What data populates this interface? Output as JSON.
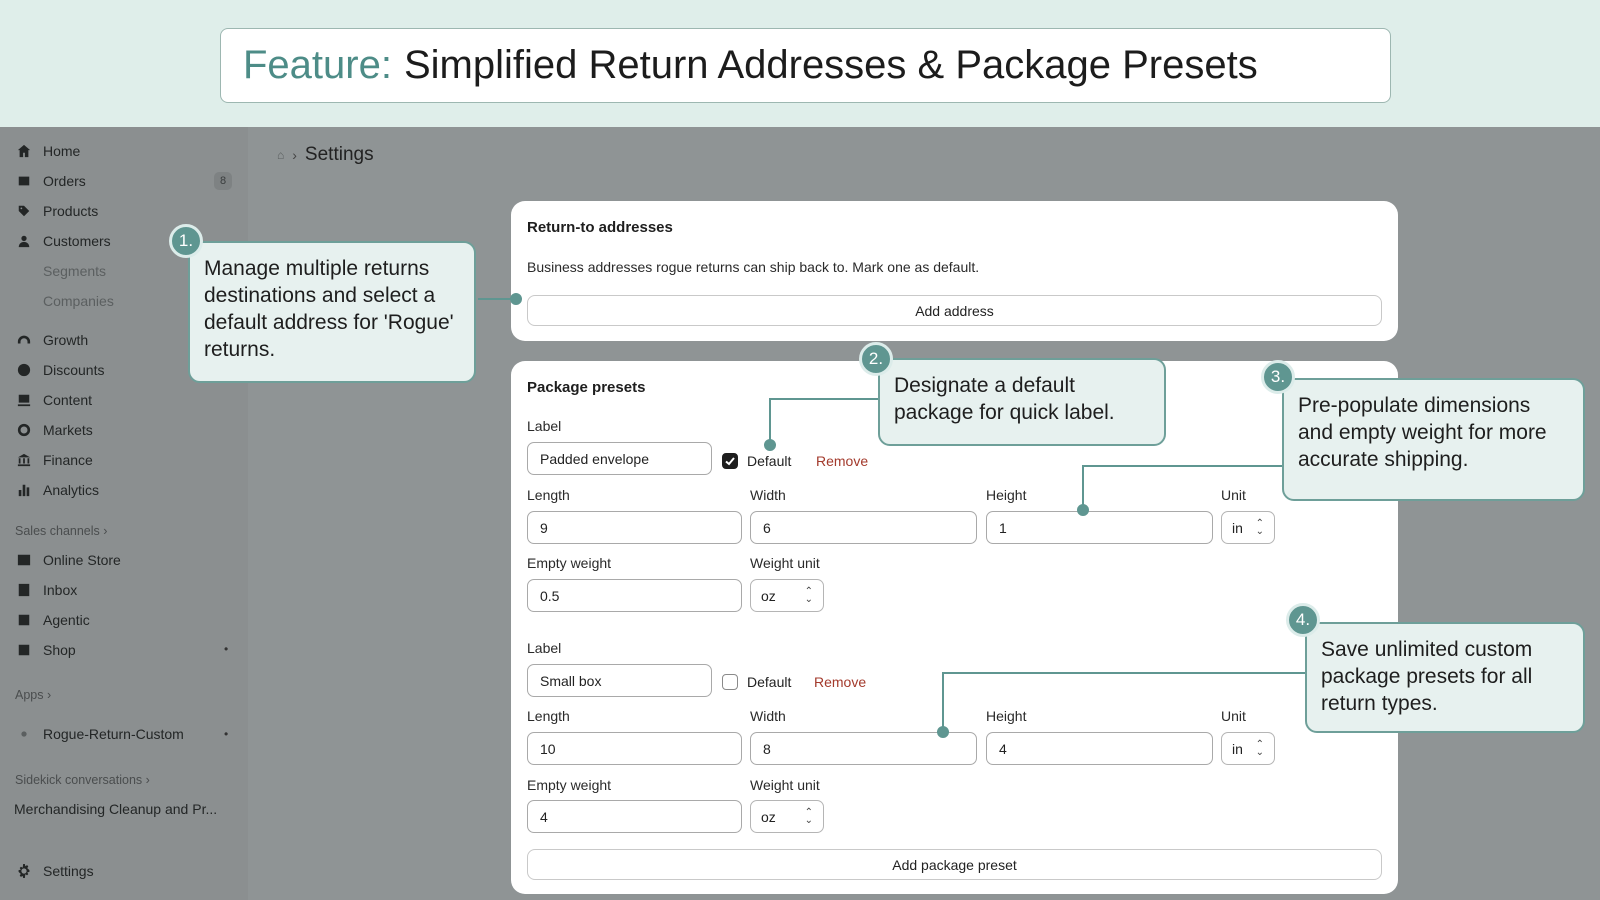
{
  "banner": {
    "keyword": "Feature:",
    "title": "Simplified Return Addresses & Package Presets"
  },
  "sidebar": {
    "items": [
      {
        "label": "Home",
        "icon": "home-icon"
      },
      {
        "label": "Orders",
        "icon": "orders-icon",
        "badge": "8"
      },
      {
        "label": "Products",
        "icon": "tag-icon"
      },
      {
        "label": "Customers",
        "icon": "person-icon"
      },
      {
        "label": "Growth",
        "icon": "gauge-icon"
      },
      {
        "label": "Discounts",
        "icon": "discount-icon"
      },
      {
        "label": "Content",
        "icon": "content-icon"
      },
      {
        "label": "Markets",
        "icon": "globe-icon"
      },
      {
        "label": "Finance",
        "icon": "bank-icon"
      },
      {
        "label": "Analytics",
        "icon": "bar-chart-icon"
      },
      {
        "label": "Online Store",
        "icon": "store-icon"
      },
      {
        "label": "Inbox",
        "icon": "inbox-icon"
      },
      {
        "label": "Agentic",
        "icon": "agentic-icon"
      },
      {
        "label": "Shop",
        "icon": "shop-icon"
      },
      {
        "label": "Rogue-Return-Custom",
        "icon": "app-icon"
      },
      {
        "label": "Settings",
        "icon": "gear-icon"
      }
    ],
    "sub_items": [
      "Segments",
      "Companies"
    ],
    "sections": {
      "sales_channels": "Sales channels",
      "apps": "Apps",
      "sidekick": "Sidekick conversations"
    },
    "conversation": "Merchandising Cleanup and Pr..."
  },
  "breadcrumb": {
    "home_glyph": "⌂",
    "page": "Settings"
  },
  "return_card": {
    "title": "Return-to addresses",
    "description": "Business addresses rogue returns can ship back to. Mark one as default.",
    "add_button": "Add address"
  },
  "presets_card": {
    "title": "Package presets",
    "labels": {
      "label": "Label",
      "default": "Default",
      "remove": "Remove",
      "length": "Length",
      "width": "Width",
      "height": "Height",
      "unit": "Unit",
      "empty_weight": "Empty weight",
      "weight_unit": "Weight unit"
    },
    "presets": [
      {
        "label": "Padded envelope",
        "is_default": true,
        "length": "9",
        "width": "6",
        "height": "1",
        "unit": "in",
        "empty_weight": "0.5",
        "weight_unit": "oz"
      },
      {
        "label": "Small box",
        "is_default": false,
        "length": "10",
        "width": "8",
        "height": "4",
        "unit": "in",
        "empty_weight": "4",
        "weight_unit": "oz"
      }
    ],
    "add_button": "Add package preset"
  },
  "callouts": [
    {
      "num": "1.",
      "text": "Manage multiple returns destinations and select a default address for 'Rogue' returns."
    },
    {
      "num": "2.",
      "text": "Designate a default package for quick label."
    },
    {
      "num": "3.",
      "text": "Pre-populate dimensions and empty weight for more accurate shipping."
    },
    {
      "num": "4.",
      "text": "Save unlimited custom package presets for all return types."
    }
  ],
  "colors": {
    "accent": "#5f9691",
    "callout_bg": "#e7f1ef",
    "remove": "#a33a2c"
  }
}
